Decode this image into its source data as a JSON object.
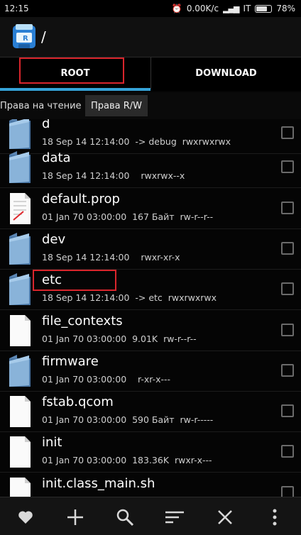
{
  "status": {
    "time": "12:15",
    "speed": "0.00K/c",
    "carrier": "IT",
    "battery": "78%",
    "battery_level": 0.78
  },
  "header": {
    "path": "/"
  },
  "tabs": [
    {
      "label": "ROOT"
    },
    {
      "label": "DOWNLOAD"
    }
  ],
  "permissions": {
    "read": "Права на чтение",
    "rw": "Права R/W"
  },
  "files": [
    {
      "name": "d",
      "meta": "18 Sep 14 12:14:00  -> debug  rwxrwxrwx",
      "icon": "folder-icon"
    },
    {
      "name": "data",
      "meta": "18 Sep 14 12:14:00    rwxrwx--x",
      "icon": "folder-icon"
    },
    {
      "name": "default.prop",
      "meta": "01 Jan 70 03:00:00  167 Байт  rw-r--r--",
      "icon": "prop-file-icon"
    },
    {
      "name": "dev",
      "meta": "18 Sep 14 12:14:00    rwxr-xr-x",
      "icon": "folder-icon"
    },
    {
      "name": "etc",
      "meta": "18 Sep 14 12:14:00  -> etc  rwxrwxrwx",
      "icon": "folder-icon"
    },
    {
      "name": "file_contexts",
      "meta": "01 Jan 70 03:00:00  9.01K  rw-r--r--",
      "icon": "file-icon"
    },
    {
      "name": "firmware",
      "meta": "01 Jan 70 03:00:00    r-xr-x---",
      "icon": "folder-icon"
    },
    {
      "name": "fstab.qcom",
      "meta": "01 Jan 70 03:00:00  590 Байт  rw-r-----",
      "icon": "file-icon"
    },
    {
      "name": "init",
      "meta": "01 Jan 70 03:00:00  183.36K  rwxr-x---",
      "icon": "file-icon"
    },
    {
      "name": "init.class_main.sh",
      "meta": "",
      "icon": "file-icon"
    }
  ],
  "toolbar": {
    "icons": [
      "heart-icon",
      "plus-icon",
      "search-icon",
      "sort-icon",
      "close-icon",
      "more-icon"
    ]
  }
}
